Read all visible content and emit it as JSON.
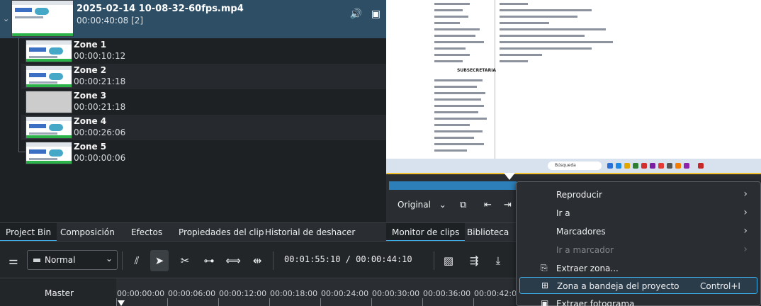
{
  "bin": {
    "clip": {
      "title": "2025-02-14 10-08-32-60fps.mp4",
      "duration": "00:00:40:08 [2]"
    },
    "zones": [
      {
        "name": "Zone 1",
        "duration": "00:00:10:12"
      },
      {
        "name": "Zone 2",
        "duration": "00:00:21:18"
      },
      {
        "name": "Zone 3",
        "duration": "00:00:21:18"
      },
      {
        "name": "Zone 4",
        "duration": "00:00:26:06"
      },
      {
        "name": "Zone 5",
        "duration": "00:00:00:06"
      }
    ]
  },
  "bottom_tabs": [
    "Project Bin",
    "Composición",
    "Efectos",
    "Propiedades del clip",
    "Historial de deshacer"
  ],
  "monitor": {
    "heading": "SUBSECRETARIA",
    "search": "Búsqueda",
    "zoom": "Original",
    "tabs": [
      "Monitor de clips",
      "Biblioteca"
    ]
  },
  "toolbar": {
    "mode": "Normal",
    "timecode": "00:01:55:10 / 00:00:44:10"
  },
  "timeline": {
    "track": "Master",
    "ticks": [
      "00:00:00:00",
      "00:00:06:00",
      "00:00:12:00",
      "00:00:18:00",
      "00:00:24:00",
      "00:00:30:00",
      "00:00:36:00",
      "00:00:42:00"
    ]
  },
  "menu": {
    "items": [
      {
        "label": "Reproducir",
        "submenu": true
      },
      {
        "label": "Ir a",
        "submenu": true
      },
      {
        "label": "Marcadores",
        "submenu": true
      },
      {
        "label": "Ir a marcador",
        "submenu": true,
        "disabled": true
      },
      {
        "label": "Extraer zona..."
      },
      {
        "label": "Zona a bandeja del proyecto",
        "shortcut": "Control+I"
      },
      {
        "label": "Extraer fotograma"
      }
    ]
  }
}
